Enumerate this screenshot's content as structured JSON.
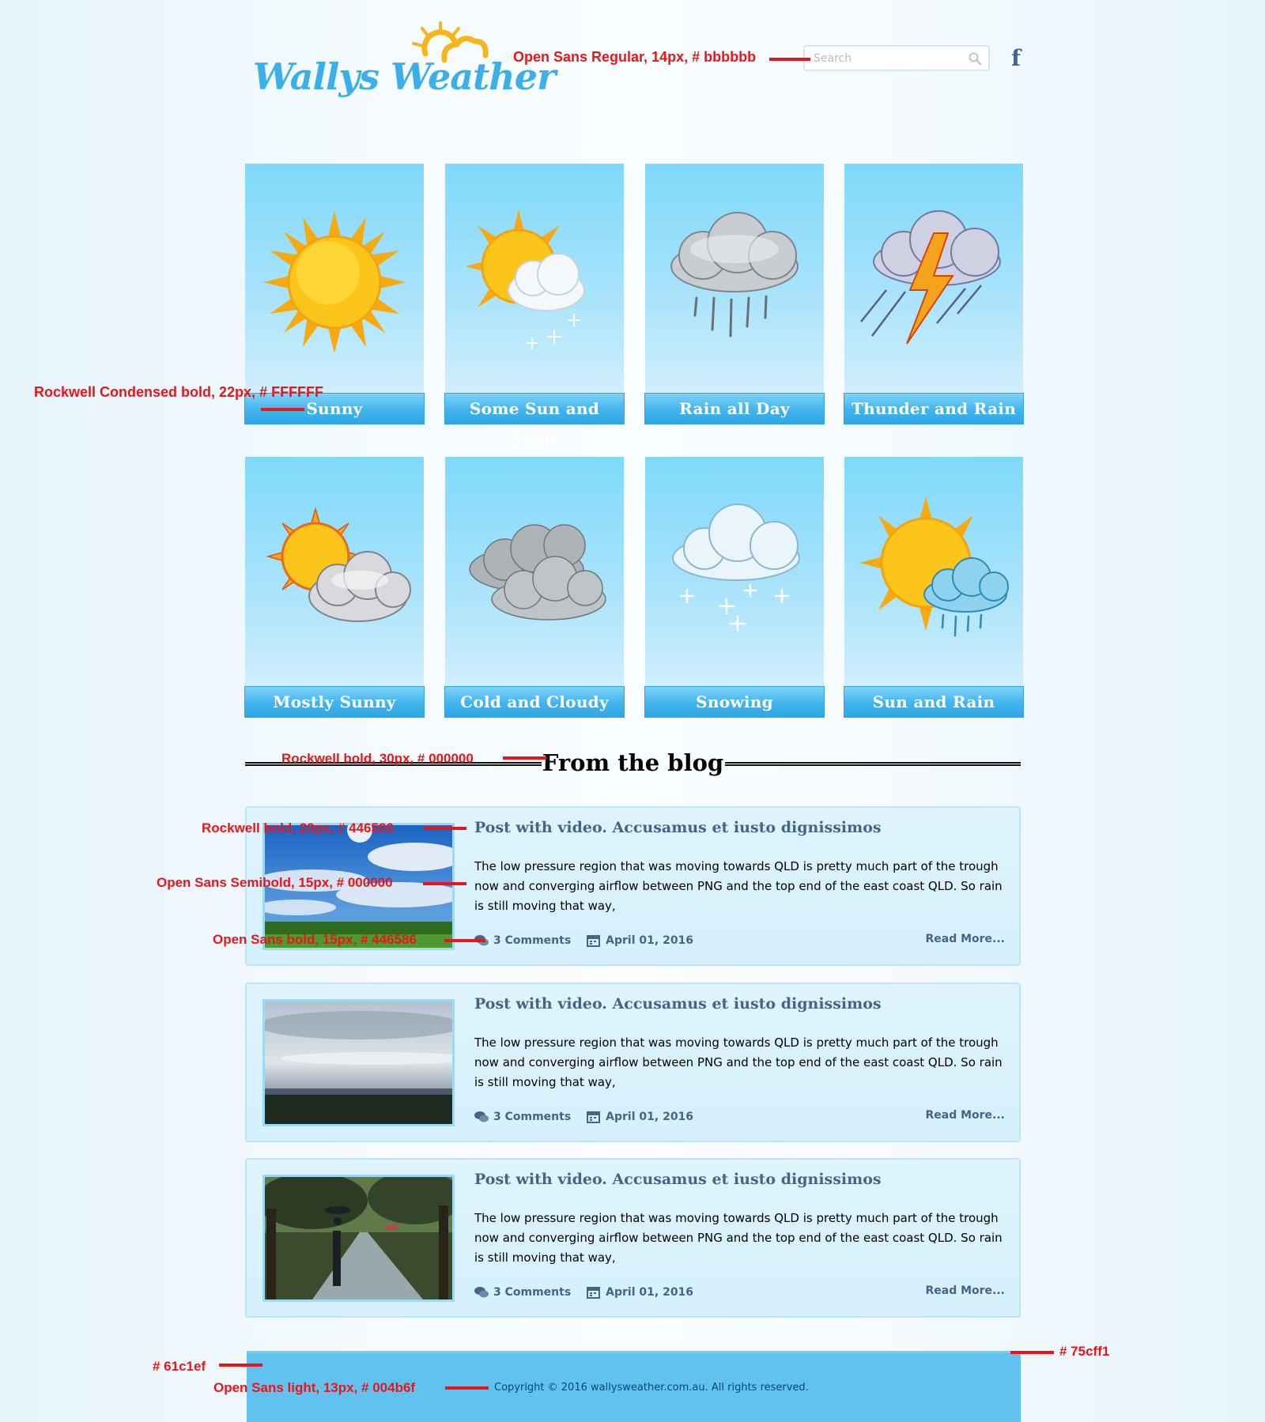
{
  "header": {
    "logo_text": "Wallys Weather",
    "search_placeholder": "Search",
    "facebook_glyph": "f"
  },
  "weather_cards": [
    {
      "label": "Sunny",
      "icon": "sun-icon"
    },
    {
      "label": "Some Sun and Snow",
      "icon": "sun-cloud-snow-icon"
    },
    {
      "label": "Rain all Day",
      "icon": "rain-cloud-icon"
    },
    {
      "label": "Thunder and Rain",
      "icon": "thunder-cloud-icon"
    },
    {
      "label": "Mostly Sunny",
      "icon": "sun-behind-cloud-icon"
    },
    {
      "label": "Cold and Cloudy",
      "icon": "grey-clouds-icon"
    },
    {
      "label": "Snowing",
      "icon": "snow-cloud-icon"
    },
    {
      "label": "Sun and Rain",
      "icon": "sun-rain-cloud-icon"
    }
  ],
  "blog": {
    "heading": "From the blog",
    "posts": [
      {
        "title": "Post with video. Accusamus et iusto dignissimos",
        "excerpt": "The low pressure region that was moving towards QLD is pretty much part of the trough now and converging airflow between PNG and the top end of the east coast QLD. So rain is still moving that way,",
        "comments": "3 Comments",
        "date": "April 01, 2016",
        "read_more": "Read More...",
        "image": "sky-with-sun-photo"
      },
      {
        "title": "Post with video. Accusamus et iusto dignissimos",
        "excerpt": "The low pressure region that was moving towards QLD is pretty much part of the trough now and converging airflow between PNG and the top end of the east coast QLD. So rain is still moving that way,",
        "comments": "3 Comments",
        "date": "April 01, 2016",
        "read_more": "Read More...",
        "image": "overcast-landscape-photo"
      },
      {
        "title": "Post with video. Accusamus et iusto dignissimos",
        "excerpt": "The low pressure region that was moving towards QLD is pretty much part of the trough now and converging airflow between PNG and the top end of the east coast QLD. So rain is still moving that way,",
        "comments": "3 Comments",
        "date": "April 01, 2016",
        "read_more": "Read More...",
        "image": "rainy-street-photo"
      }
    ]
  },
  "footer": {
    "copyright": "Copyright © 2016 wallysweather.com.au. All rights reserved.",
    "background": "#61c1ef",
    "border": "#75cff1"
  },
  "annotations": {
    "search_font": "Open Sans Regular, 14px, # bbbbbb",
    "card_label_font": "Rockwell Condensed bold, 22px, # FFFFFF",
    "heading_font": "Rockwell bold, 30px, # 000000",
    "post_title_font": "Rockwell bold, 20px, # 446586",
    "post_excerpt_font": "Open Sans Semibold, 15px, # 000000",
    "post_meta_font": "Open Sans bold, 15px, # 446586",
    "footer_border_color": "# 75cff1",
    "footer_bg_color": "# 61c1ef",
    "copyright_font": "Open Sans light, 13px, # 004b6f"
  },
  "colors": {
    "card_top": "#7fd9fb",
    "label_blue": "#2ea7e6",
    "post_text": "#446586"
  }
}
